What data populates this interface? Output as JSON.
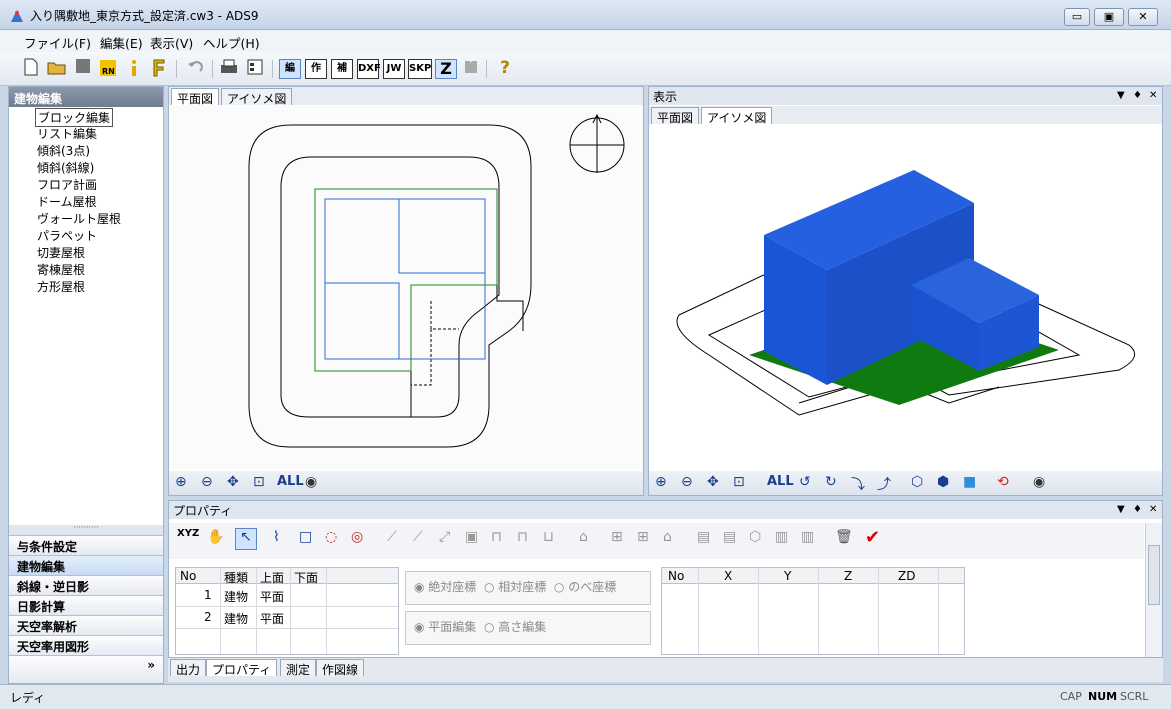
{
  "window": {
    "title": "入り隅敷地_東京方式_設定済.cw3 - ADS9",
    "min": "▭",
    "max": "▣",
    "close": "✕"
  },
  "menu": [
    "ファイル(F)",
    "編集(E)",
    "表示(V)",
    "ヘルプ(H)"
  ],
  "toolbar": {
    "mode_buttons": [
      "編",
      "作",
      "補",
      "DXF",
      "JW",
      "SKP",
      "Z"
    ],
    "help": "?"
  },
  "left_panel": {
    "header": "建物編集",
    "tree": [
      "ブロック編集",
      "リスト編集",
      "傾斜(3点)",
      "傾斜(斜線)",
      "フロア計画",
      "ドーム屋根",
      "ヴォールト屋根",
      "パラペット",
      "切妻屋根",
      "寄棟屋根",
      "方形屋根"
    ],
    "nav": [
      "与条件設定",
      "建物編集",
      "斜線・逆日影",
      "日影計算",
      "天空率解析",
      "天空率用図形"
    ],
    "more": "»"
  },
  "plan_view": {
    "tabs": [
      "平面図",
      "アイソメ図"
    ],
    "all": "ALL"
  },
  "iso_view": {
    "title": "表示",
    "tabs": [
      "平面図",
      "アイソメ図"
    ],
    "all": "ALL",
    "colors": {
      "building": "#1a55d6",
      "ground": "#0f7a0f"
    }
  },
  "properties": {
    "title": "プロパティ",
    "table_headers": [
      "No",
      "種類",
      "上面",
      "下面"
    ],
    "rows": [
      [
        "1",
        "建物",
        "平面",
        ""
      ],
      [
        "2",
        "建物",
        "平面",
        ""
      ]
    ],
    "coord_options": [
      "絶対座標",
      "相対座標",
      "のべ座標"
    ],
    "edit_options": [
      "平面編集",
      "高さ編集"
    ],
    "xyz_headers": [
      "No",
      "X",
      "Y",
      "Z",
      "ZD"
    ],
    "xyz_btn": "XYZ"
  },
  "bottom_tabs": [
    "出力",
    "プロパティ",
    "測定",
    "作図線"
  ],
  "status": {
    "text": "レディ",
    "cap": "CAP",
    "num": "NUM",
    "scrl": "SCRL"
  }
}
